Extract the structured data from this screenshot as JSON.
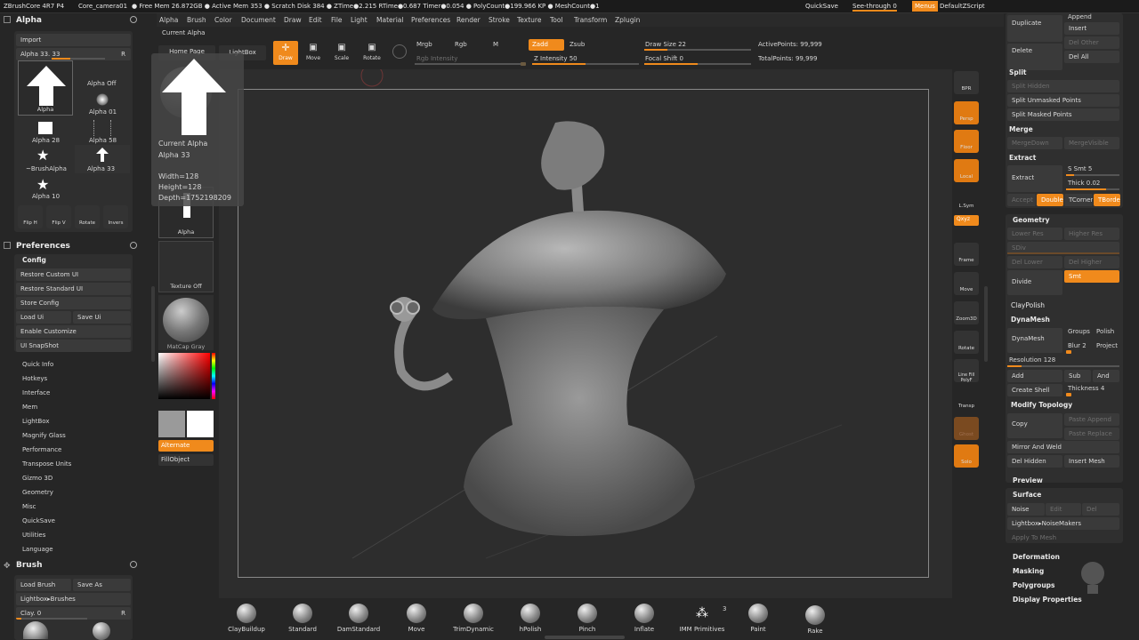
{
  "topbar": {
    "app": "ZBrushCore 4R7 P4",
    "doc": "Core_camera01",
    "stats": "● Free Mem 26.872GB ● Active Mem 353 ● Scratch Disk 384 ●  ZTime●2.215 RTime●0.687 Timer●0.054 ● PolyCount●199.966 KP ● MeshCount●1",
    "quicksave": "QuickSave",
    "seethrough": "See-through",
    "seethrough_val": "0",
    "menus": "Menus",
    "script": "DefaultZScript"
  },
  "menubar": [
    "Alpha",
    "Brush",
    "Color",
    "Document",
    "Draw",
    "Edit",
    "File",
    "Light",
    "Material",
    "Preferences",
    "Render",
    "Stroke",
    "Texture",
    "Tool",
    "Transform",
    "Zplugin"
  ],
  "alpha_panel": {
    "title": "Alpha",
    "import": "Import",
    "slider_label": "Alpha 33.  33",
    "slider_r": "R",
    "items": [
      "Alpha",
      "Alpha Off",
      "Alpha 01",
      "Alpha 28",
      "Alpha 58",
      "~BrushAlpha",
      "Alpha 33",
      "Alpha 10"
    ],
    "tools": [
      "Flip H",
      "Flip V",
      "Rotate",
      "Invers"
    ]
  },
  "preferences": {
    "title": "Preferences",
    "config": "Config",
    "buttons": [
      "Restore Custom UI",
      "Restore Standard UI",
      "Store Config",
      "Load Ui",
      "Save Ui",
      "Enable Customize",
      "UI SnapShot"
    ],
    "list": [
      "Quick Info",
      "Hotkeys",
      "Interface",
      "Mem",
      "LightBox",
      "Magnify Glass",
      "Performance",
      "Transpose Units",
      "Gizmo 3D",
      "Geometry",
      "Misc",
      "QuickSave",
      "Utilities",
      "Language"
    ]
  },
  "brush_panel": {
    "title": "Brush",
    "load": "Load Brush",
    "saveas": "Save As",
    "lightbox": "Lightbox▸Brushes",
    "slider_label": "Clay. 0",
    "slider_r": "R"
  },
  "shelf": {
    "current_alpha_label": "Current Alpha",
    "home_page": "Home Page",
    "lightbox": "LightBox",
    "alpha_thumb": "Alpha",
    "texture_off": "Texture Off",
    "matcap": "MatCap Gray",
    "alternate": "Alternate",
    "fillobject": "FillObject"
  },
  "tooltip": {
    "title": "Current Alpha",
    "name": "Alpha 33",
    "width": "Width=128",
    "height": "Height=128",
    "depth": "Depth=1752198209"
  },
  "toolbar": {
    "draw": "Draw",
    "move": "Move",
    "scale": "Scale",
    "rotate": "Rotate",
    "mrgb": "Mrgb",
    "rgb": "Rgb",
    "m": "M",
    "zadd": "Zadd",
    "zsub": "Zsub",
    "rgb_intensity": "Rgb Intensity",
    "z_intensity": "Z Intensity 50",
    "z_intensity_value": 0.5,
    "draw_size": "Draw Size 22",
    "draw_size_value": 0.22,
    "focal_shift": "Focal Shift 0",
    "focal_shift_value": 0.5,
    "active_points": "ActivePoints: 99,999",
    "total_points": "TotalPoints: 99,999"
  },
  "right_icons": [
    "BPR",
    "Persp",
    "Floor",
    "Local",
    "L.Sym",
    "Qxyz",
    "Frame",
    "Move",
    "Zoom3D",
    "Rotate",
    "Line Fill PolyF",
    "Transp",
    "Ghost",
    "Solo"
  ],
  "tool_panel": {
    "append": "Append",
    "duplicate": "Duplicate",
    "insert": "Insert",
    "delete": "Delete",
    "del_other": "Del Other",
    "del_all": "Del All",
    "split": "Split",
    "split_hidden": "Split Hidden",
    "split_unmasked": "Split Unmasked Points",
    "split_masked": "Split Masked Points",
    "merge": "Merge",
    "merge_down": "MergeDown",
    "merge_visible": "MergeVisible",
    "extract_head": "Extract",
    "extract": "Extract",
    "s_smt": "S Smt 5",
    "thick": "Thick 0.02",
    "accept": "Accept",
    "double": "Double",
    "tcorner": "TCorner",
    "tborder": "TBorder",
    "geometry": "Geometry",
    "lower_res": "Lower Res",
    "higher_res": "Higher Res",
    "sdiv": "SDiv",
    "del_lower": "Del Lower",
    "del_higher": "Del Higher",
    "divide": "Divide",
    "smt": "Smt",
    "claypolish": "ClayPolish",
    "dynamesh_head": "DynaMesh",
    "dynamesh": "DynaMesh",
    "groups": "Groups",
    "polish": "Polish",
    "blur": "Blur 2",
    "project": "Project",
    "resolution": "Resolution 128",
    "add": "Add",
    "sub": "Sub",
    "and": "And",
    "create_shell": "Create Shell",
    "thickness": "Thickness 4",
    "modify_topology": "Modify Topology",
    "copy": "Copy",
    "paste_append": "Paste Append",
    "paste_replace": "Paste Replace",
    "mirror_weld": "Mirror And Weld",
    "del_hidden": "Del Hidden",
    "insert_mesh": "Insert Mesh",
    "preview": "Preview",
    "surface": "Surface",
    "noise": "Noise",
    "edit": "Edit",
    "del": "Del",
    "lightbox_noise": "Lightbox▸NoiseMakers",
    "apply_to_mesh": "Apply To Mesh",
    "deformation": "Deformation",
    "masking": "Masking",
    "polygroups": "Polygroups",
    "display_properties": "Display Properties"
  },
  "brushes": [
    "ClayBuildup",
    "Standard",
    "DamStandard",
    "Move",
    "TrimDynamic",
    "hPolish",
    "Pinch",
    "Inflate",
    "IMM Primitives",
    "Paint",
    "Rake"
  ],
  "brush_count": "3",
  "colors": {
    "accent": "#f08a1c",
    "bg": "#262626",
    "panel": "#2b2b2b"
  }
}
